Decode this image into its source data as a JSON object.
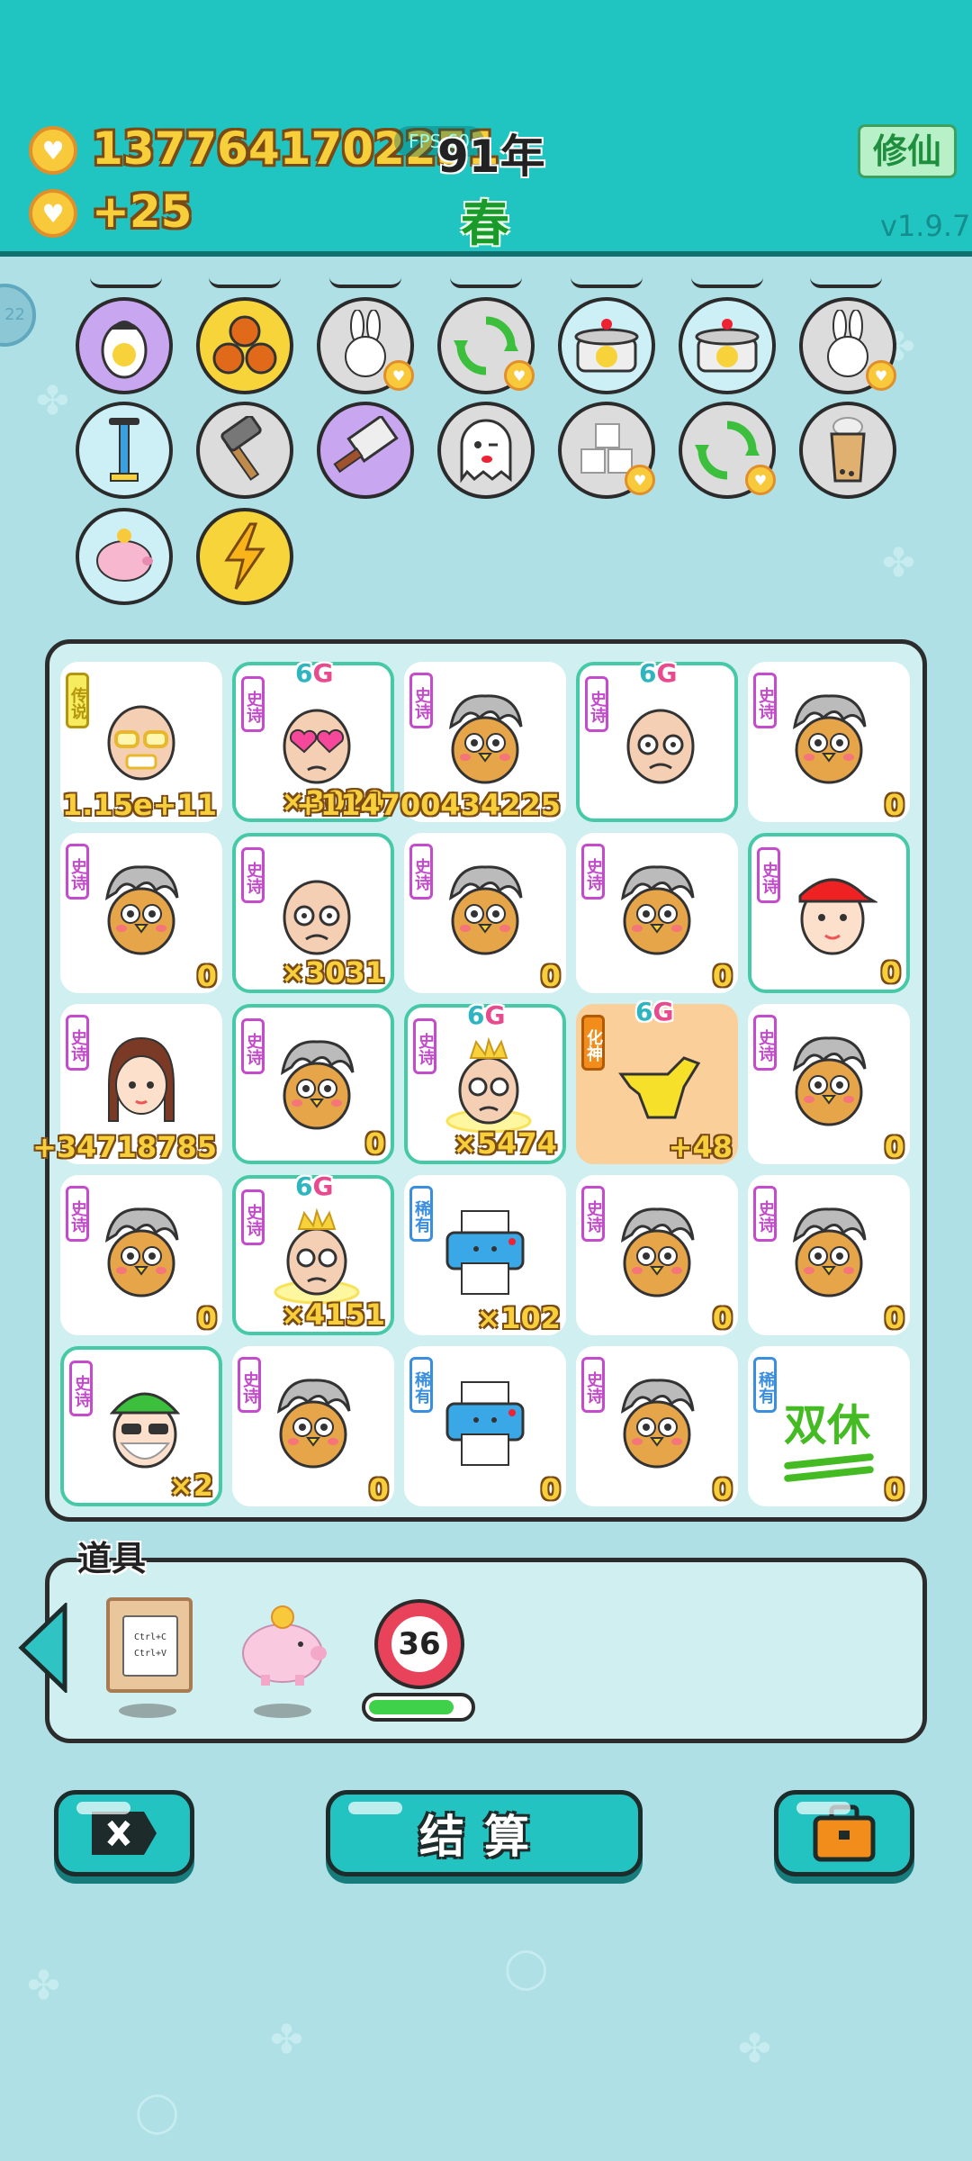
{
  "header": {
    "coins": "1377641702251",
    "fps_label": "FPS 60",
    "year": "91年",
    "income": "+25",
    "season": "春",
    "mode_button": "修仙",
    "version": "v1.9.7"
  },
  "side_badge": "22",
  "relics": [
    {
      "icon": "egg-person-icon"
    },
    {
      "icon": "basketballs-icon"
    },
    {
      "icon": "rabbit-icon"
    },
    {
      "icon": "recycle-icon"
    },
    {
      "icon": "duck-pot-icon"
    },
    {
      "icon": "duck-pot-icon"
    },
    {
      "icon": "rabbit-icon"
    },
    {
      "icon": "pump-icon"
    },
    {
      "icon": "hammer-icon"
    },
    {
      "icon": "cleaver-icon"
    },
    {
      "icon": "ghost-icon"
    },
    {
      "icon": "sugar-cubes-icon"
    },
    {
      "icon": "recycle-icon"
    },
    {
      "icon": "bubble-tea-icon"
    },
    {
      "icon": "piggy-bank-icon"
    },
    {
      "icon": "lightning-icon"
    }
  ],
  "board": {
    "cells": [
      {
        "tag": "传说",
        "tag_type": "legend",
        "avatar": "old-man-gold-glasses",
        "count": "1.15e+11",
        "hl": false
      },
      {
        "tag": "史诗",
        "tag_type": "epic",
        "avatar": "old-man-heart-glasses",
        "count": "×3029",
        "hl": true,
        "sixg": true
      },
      {
        "tag": "史诗",
        "tag_type": "epic",
        "avatar": "chick-gray-hair",
        "count": "+114700434225",
        "hl": false
      },
      {
        "tag": "史诗",
        "tag_type": "epic",
        "avatar": "old-man-glasses",
        "count": "",
        "hl": true,
        "sixg": true
      },
      {
        "tag": "史诗",
        "tag_type": "epic",
        "avatar": "chick-gray-hair",
        "count": "0",
        "hl": false
      },
      {
        "tag": "史诗",
        "tag_type": "epic",
        "avatar": "chick-gray-hair",
        "count": "0",
        "hl": false
      },
      {
        "tag": "史诗",
        "tag_type": "epic",
        "avatar": "old-man-glasses",
        "count": "×3031",
        "hl": true
      },
      {
        "tag": "史诗",
        "tag_type": "epic",
        "avatar": "chick-gray-hair",
        "count": "0",
        "hl": false
      },
      {
        "tag": "史诗",
        "tag_type": "epic",
        "avatar": "chick-gray-hair",
        "count": "0",
        "hl": false
      },
      {
        "tag": "史诗",
        "tag_type": "epic",
        "avatar": "boy-red-cap",
        "count": "0",
        "hl": true
      },
      {
        "tag": "史诗",
        "tag_type": "epic",
        "avatar": "girl-braids",
        "count": "+34718785",
        "hl": false
      },
      {
        "tag": "史诗",
        "tag_type": "epic",
        "avatar": "chick-gray-hair",
        "count": "0",
        "hl": true
      },
      {
        "tag": "史诗",
        "tag_type": "epic",
        "avatar": "king-old-man",
        "count": "×5474",
        "hl": true,
        "sixg": true
      },
      {
        "tag": "化神",
        "tag_type": "huashen",
        "avatar": "pointing-hand",
        "count": "+48",
        "hl": false,
        "sixg": true,
        "orange": true
      },
      {
        "tag": "史诗",
        "tag_type": "epic",
        "avatar": "chick-gray-hair",
        "count": "0",
        "hl": false
      },
      {
        "tag": "史诗",
        "tag_type": "epic",
        "avatar": "chick-gray-hair",
        "count": "0",
        "hl": false
      },
      {
        "tag": "史诗",
        "tag_type": "epic",
        "avatar": "king-old-man",
        "count": "×4151",
        "hl": true,
        "sixg": true
      },
      {
        "tag": "稀有",
        "tag_type": "rare",
        "avatar": "printer",
        "count": "×102",
        "hl": false
      },
      {
        "tag": "史诗",
        "tag_type": "epic",
        "avatar": "chick-gray-hair",
        "count": "0",
        "hl": false
      },
      {
        "tag": "史诗",
        "tag_type": "epic",
        "avatar": "chick-gray-hair",
        "count": "0",
        "hl": false
      },
      {
        "tag": "史诗",
        "tag_type": "epic",
        "avatar": "green-hat-man",
        "count": "×2",
        "hl": true
      },
      {
        "tag": "史诗",
        "tag_type": "epic",
        "avatar": "chick-gray-hair",
        "count": "0",
        "hl": false
      },
      {
        "tag": "稀有",
        "tag_type": "rare",
        "avatar": "printer",
        "count": "0",
        "hl": false
      },
      {
        "tag": "史诗",
        "tag_type": "epic",
        "avatar": "chick-gray-hair",
        "count": "0",
        "hl": false
      },
      {
        "tag": "稀有",
        "tag_type": "rare",
        "avatar": "double-rest",
        "count": "0",
        "hl": false,
        "text": "双休"
      }
    ]
  },
  "items": {
    "title": "道具",
    "clipboard_line1": "Ctrl+C",
    "clipboard_line2": "Ctrl+V",
    "timer_value": "36",
    "timer_progress": 0.85
  },
  "buttons": {
    "settle": "结算"
  },
  "colors": {
    "header_bg": "#20c4c1",
    "bg": "#aee0e6",
    "coin_text": "#f6cf3a",
    "epic": "#c44ccc",
    "rare": "#3a8ee0",
    "legend": "#f7ec60",
    "highlight": "#45c9a6"
  }
}
